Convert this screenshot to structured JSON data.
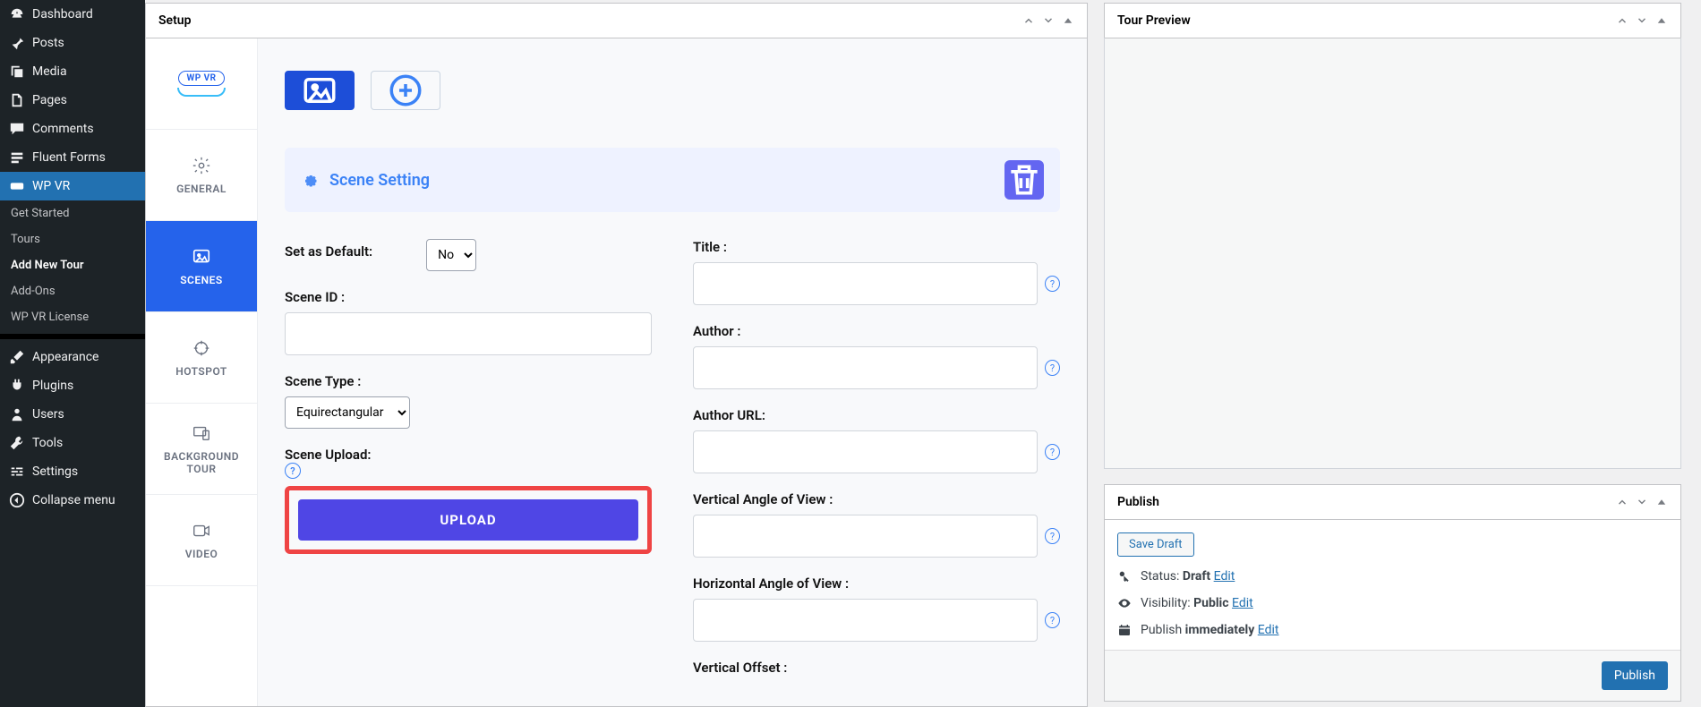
{
  "sidebar": {
    "main": [
      {
        "icon": "dashboard",
        "label": "Dashboard"
      },
      {
        "icon": "pin",
        "label": "Posts"
      },
      {
        "icon": "media",
        "label": "Media"
      },
      {
        "icon": "pages",
        "label": "Pages"
      },
      {
        "icon": "comments",
        "label": "Comments"
      },
      {
        "icon": "forms",
        "label": "Fluent Forms"
      },
      {
        "icon": "vr",
        "label": "WP VR",
        "active": true
      }
    ],
    "sub": [
      {
        "label": "Get Started"
      },
      {
        "label": "Tours"
      },
      {
        "label": "Add New Tour",
        "bold": true
      },
      {
        "label": "Add-Ons"
      },
      {
        "label": "WP VR License"
      }
    ],
    "lower": [
      {
        "icon": "brush",
        "label": "Appearance"
      },
      {
        "icon": "plug",
        "label": "Plugins"
      },
      {
        "icon": "user",
        "label": "Users"
      },
      {
        "icon": "wrench",
        "label": "Tools"
      },
      {
        "icon": "settings",
        "label": "Settings"
      },
      {
        "icon": "collapse",
        "label": "Collapse menu"
      }
    ]
  },
  "setup": {
    "title": "Setup",
    "logo_text": "WP VR",
    "tabs": [
      {
        "id": "general",
        "label": "GENERAL"
      },
      {
        "id": "scenes",
        "label": "SCENES",
        "active": true
      },
      {
        "id": "hotspot",
        "label": "HOTSPOT"
      },
      {
        "id": "bgtour",
        "label": "BACKGROUND TOUR"
      },
      {
        "id": "video",
        "label": "VIDEO"
      }
    ],
    "scene_setting": "Scene Setting",
    "fields_left": {
      "default_label": "Set as Default:",
      "default_value": "No",
      "scene_id_label": "Scene ID :",
      "scene_type_label": "Scene Type :",
      "scene_type_value": "Equirectangular",
      "scene_upload_label": "Scene Upload:",
      "upload_btn": "UPLOAD"
    },
    "fields_right": {
      "title": "Title :",
      "author": "Author :",
      "author_url": "Author URL:",
      "vaov": "Vertical Angle of View :",
      "haov": "Horizontal Angle of View :",
      "voffset": "Vertical Offset :"
    }
  },
  "preview": {
    "title": "Tour Preview"
  },
  "publish": {
    "title": "Publish",
    "save_draft": "Save Draft",
    "status_label": "Status:",
    "status_value": "Draft",
    "visibility_label": "Visibility:",
    "visibility_value": "Public",
    "schedule_label": "Publish",
    "schedule_value": "immediately",
    "edit": "Edit",
    "publish_btn": "Publish"
  }
}
